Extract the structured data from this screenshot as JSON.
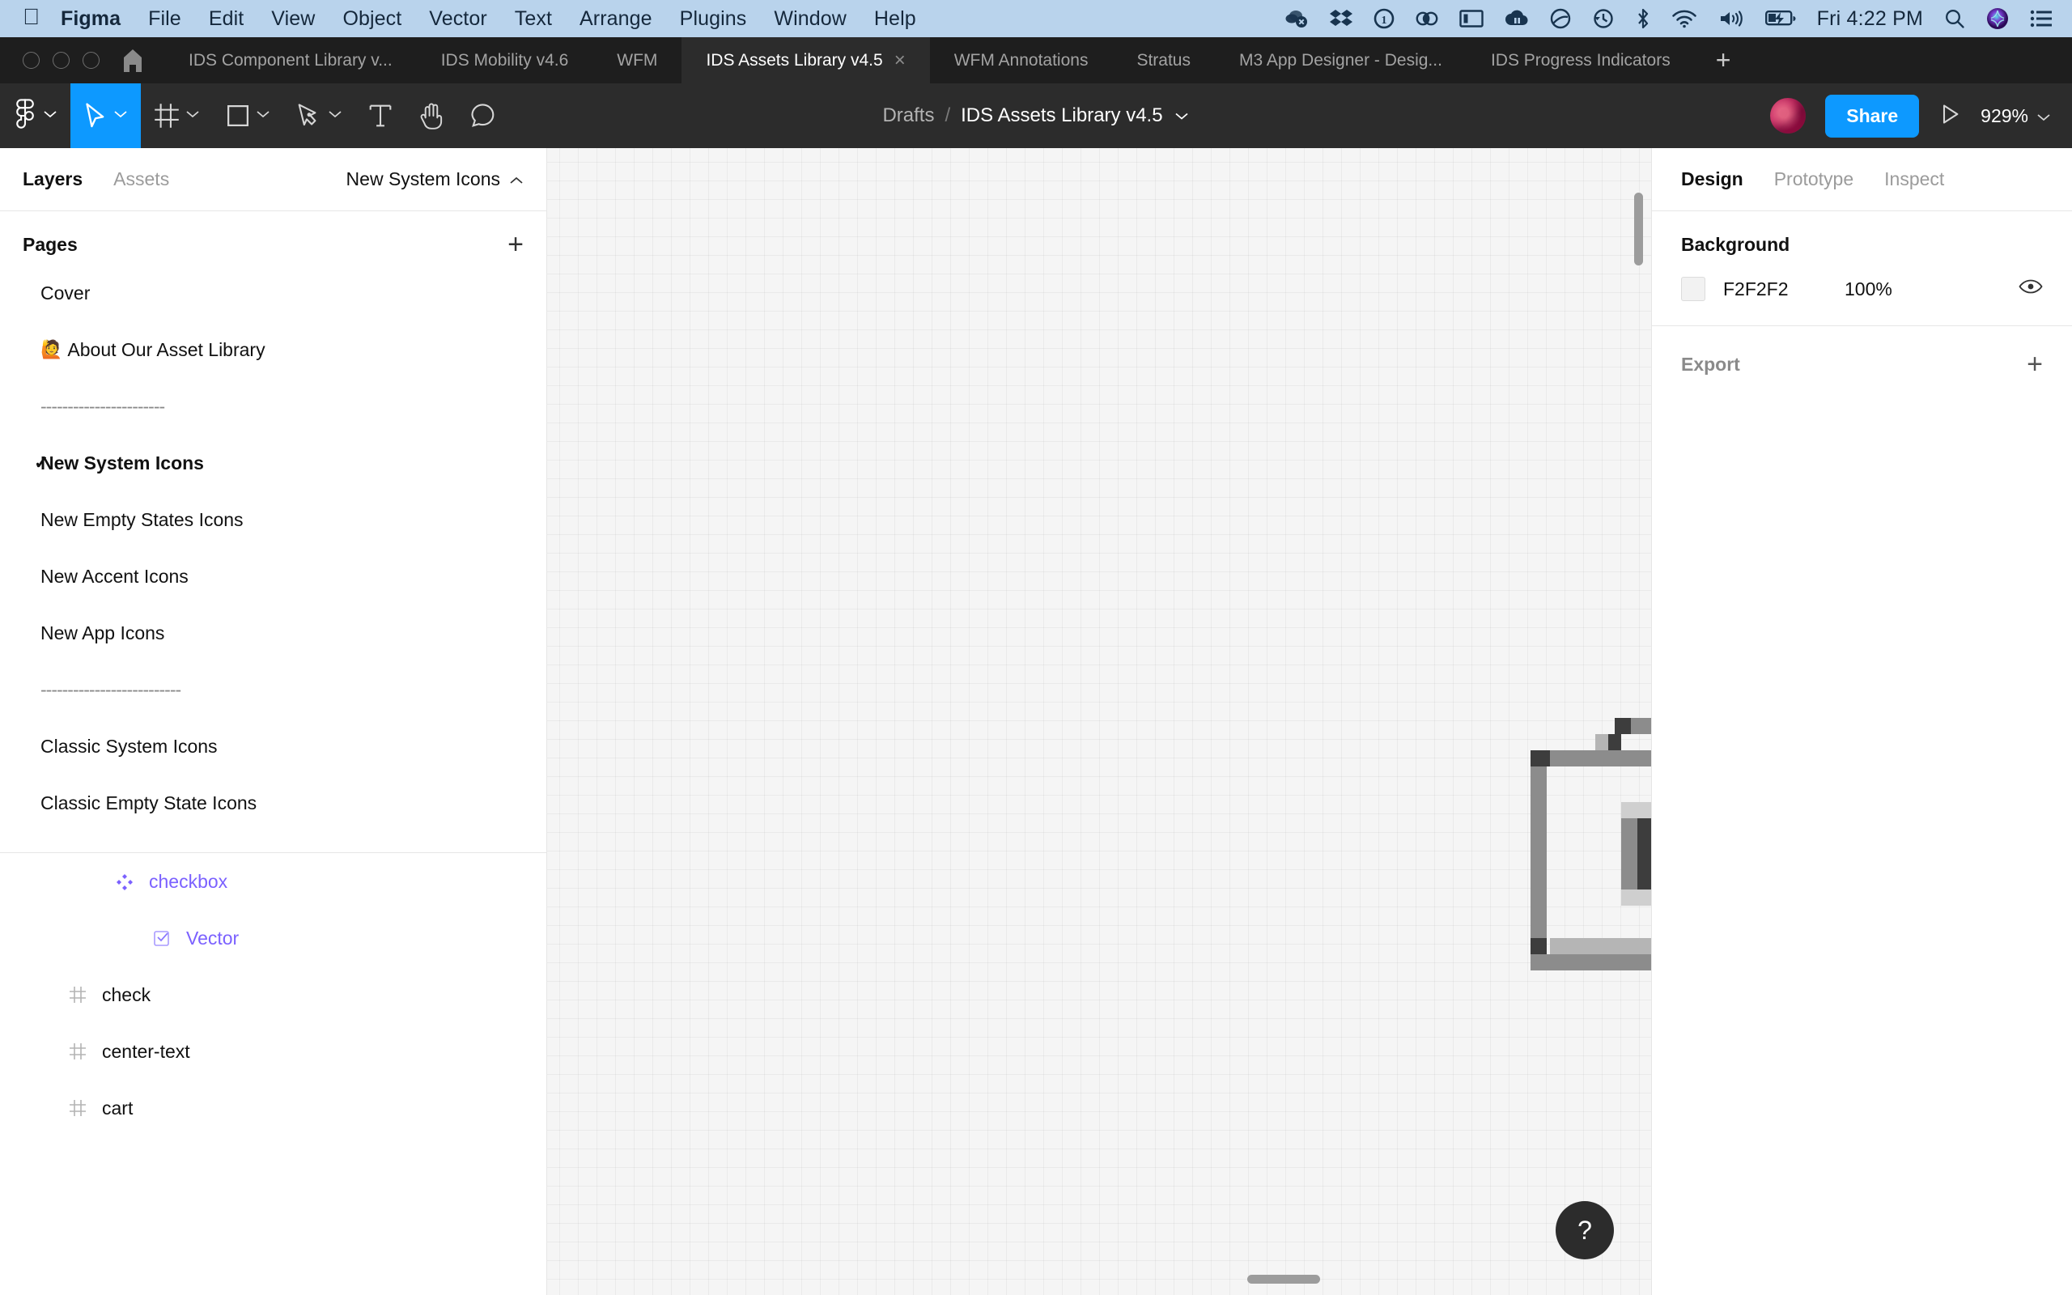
{
  "menubar": {
    "apple_icon": "apple-logo-icon",
    "items": [
      {
        "label": "Figma",
        "bold": true
      },
      {
        "label": "File",
        "bold": false
      },
      {
        "label": "Edit",
        "bold": false
      },
      {
        "label": "View",
        "bold": false
      },
      {
        "label": "Object",
        "bold": false
      },
      {
        "label": "Vector",
        "bold": false
      },
      {
        "label": "Text",
        "bold": false
      },
      {
        "label": "Arrange",
        "bold": false
      },
      {
        "label": "Plugins",
        "bold": false
      },
      {
        "label": "Window",
        "bold": false
      },
      {
        "label": "Help",
        "bold": false
      }
    ],
    "status_icons": [
      "cloud-sync-error-icon",
      "dropbox-icon",
      "one-password-icon",
      "adobe-creative-cloud-icon",
      "display-screen-icon",
      "cloud-pause-icon",
      "no-entry-circle-icon",
      "time-machine-icon",
      "bluetooth-icon",
      "wifi-icon",
      "volume-icon",
      "battery-charging-icon"
    ],
    "clock": "Fri 4:22 PM",
    "search_icon": "search-icon",
    "siri_icon": "siri-icon",
    "control_center_icon": "control-center-icon",
    "bar_color": "#b9d3ec"
  },
  "tabbar": {
    "home_icon": "figma-home-icon",
    "window_controls": [
      "close-button",
      "minimize-button",
      "maximize-button"
    ],
    "tabs": [
      {
        "label": "IDS Component Library v...",
        "active": false
      },
      {
        "label": "IDS Mobility v4.6",
        "active": false
      },
      {
        "label": "WFM",
        "active": false
      },
      {
        "label": "IDS Assets Library v4.5",
        "active": true
      },
      {
        "label": "WFM Annotations",
        "active": false
      },
      {
        "label": "Stratus",
        "active": false
      },
      {
        "label": "M3 App Designer - Desig...",
        "active": false
      },
      {
        "label": "IDS Progress Indicators",
        "active": false
      }
    ],
    "close_label": "×",
    "new_tab_label": "+"
  },
  "toolbar": {
    "tools": [
      {
        "name": "figma-menu-icon",
        "has_chevron": true,
        "selected": false
      },
      {
        "name": "move-cursor-icon",
        "has_chevron": true,
        "selected": true
      },
      {
        "name": "frame-icon",
        "has_chevron": true,
        "selected": false
      },
      {
        "name": "rectangle-icon",
        "has_chevron": true,
        "selected": false
      },
      {
        "name": "pen-icon",
        "has_chevron": true,
        "selected": false
      },
      {
        "name": "text-icon",
        "has_chevron": false,
        "selected": false
      },
      {
        "name": "hand-icon",
        "has_chevron": false,
        "selected": false
      },
      {
        "name": "comment-icon",
        "has_chevron": false,
        "selected": false
      }
    ],
    "breadcrumb_project": "Drafts",
    "breadcrumb_separator": "/",
    "file_name": "IDS Assets Library v4.5",
    "file_menu_chevron": "chevron-down-icon",
    "avatar": "user-avatar",
    "share_label": "Share",
    "present_icon": "present-play-icon",
    "zoom_level": "929%",
    "accent_color": "#0d99ff"
  },
  "left_panel": {
    "tabs": [
      {
        "label": "Layers",
        "active": true
      },
      {
        "label": "Assets",
        "active": false
      }
    ],
    "page_selector": {
      "label": "New System Icons",
      "chevron": "chevron-up-icon"
    },
    "pages_header": {
      "title": "Pages",
      "add_label": "+"
    },
    "pages": [
      {
        "label": "Cover",
        "emoji": "",
        "selected": false,
        "divider": false
      },
      {
        "label": "About Our Asset Library",
        "emoji": "🙋",
        "selected": false,
        "divider": false
      },
      {
        "label": "-----------------------",
        "emoji": "",
        "selected": false,
        "divider": true
      },
      {
        "label": "New System Icons",
        "emoji": "",
        "selected": true,
        "divider": false
      },
      {
        "label": "New Empty States Icons",
        "emoji": "",
        "selected": false,
        "divider": false
      },
      {
        "label": "New Accent Icons",
        "emoji": "",
        "selected": false,
        "divider": false
      },
      {
        "label": "New App Icons",
        "emoji": "",
        "selected": false,
        "divider": false
      },
      {
        "label": "--------------------------",
        "emoji": "",
        "selected": false,
        "divider": true
      },
      {
        "label": "Classic System Icons",
        "emoji": "",
        "selected": false,
        "divider": false
      },
      {
        "label": "Classic Empty State Icons",
        "emoji": "",
        "selected": false,
        "divider": false
      }
    ],
    "selected_check": "✓",
    "layers": [
      {
        "label": "checkbox",
        "icon": "component-instance-icon",
        "kind": "inst"
      },
      {
        "label": "Vector",
        "icon": "vector-checkbox-icon",
        "kind": "vec"
      },
      {
        "label": "check",
        "icon": "frame-hash-icon",
        "kind": "frame"
      },
      {
        "label": "center-text",
        "icon": "frame-hash-icon",
        "kind": "frame"
      },
      {
        "label": "cart",
        "icon": "frame-hash-icon",
        "kind": "frame"
      }
    ],
    "component_color": "#7b61ff"
  },
  "canvas": {
    "artwork_name": "camera-icon-pixel-preview",
    "background_color": "#f5f5f5",
    "help_label": "?",
    "vertical_scrollbar": "vertical-scrollbar",
    "horizontal_scrollbar": "horizontal-scrollbar"
  },
  "right_panel": {
    "tabs": [
      {
        "label": "Design",
        "active": true
      },
      {
        "label": "Prototype",
        "active": false
      },
      {
        "label": "Inspect",
        "active": false
      }
    ],
    "background": {
      "title": "Background",
      "hex": "F2F2F2",
      "opacity": "100%",
      "visibility_icon": "eye-icon",
      "swatch_color": "#f2f2f2"
    },
    "export": {
      "title": "Export",
      "add_label": "+"
    }
  }
}
